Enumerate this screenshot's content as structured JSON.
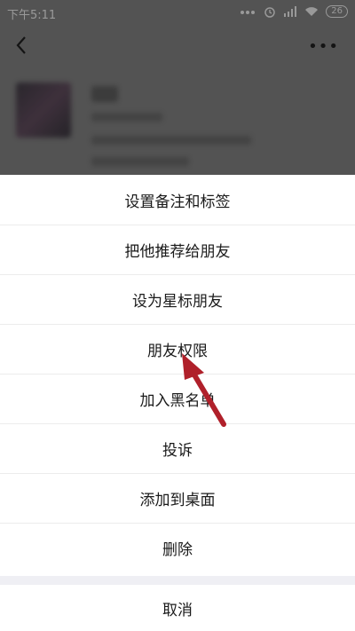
{
  "status_bar": {
    "time": "下午5:11",
    "battery": "26"
  },
  "menu": {
    "items": [
      "设置备注和标签",
      "把他推荐给朋友",
      "设为星标朋友",
      "朋友权限",
      "加入黑名单",
      "投诉",
      "添加到桌面",
      "删除"
    ],
    "cancel": "取消"
  },
  "colors": {
    "arrow": "#b0202a"
  },
  "icons": [
    "back-icon",
    "more-icon",
    "signal-icon",
    "wifi-icon",
    "alarm-icon"
  ]
}
